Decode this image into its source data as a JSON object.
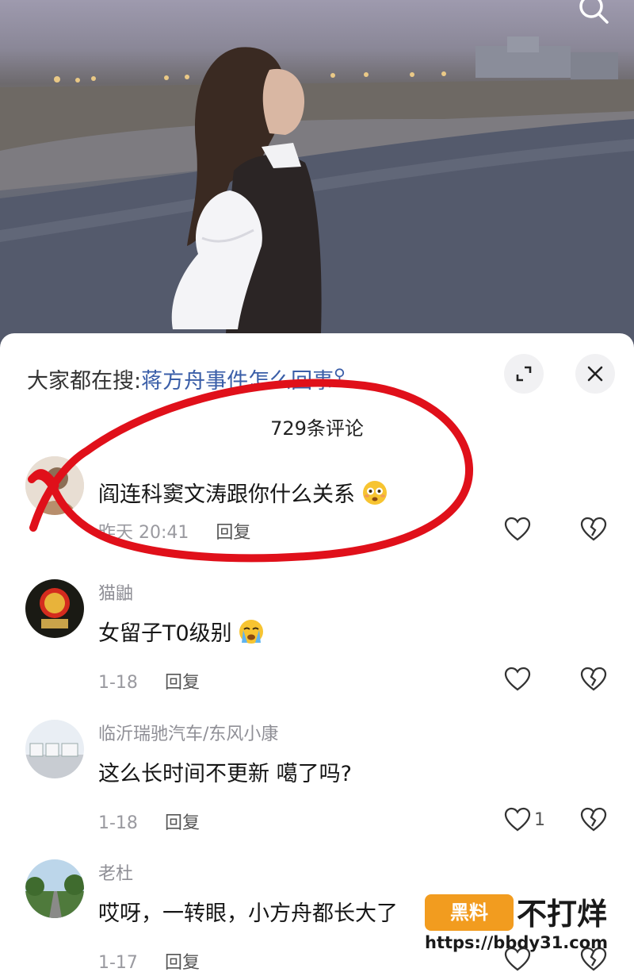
{
  "hot_search": {
    "prefix": "大家都在搜:",
    "query": "蒋方舟事件怎么回事",
    "icon": "search-icon"
  },
  "comment_count_label": "729条评论",
  "comments": [
    {
      "username": "",
      "text": "阎连科窦文涛跟你什么关系",
      "emoji": "flushed-face-emoji",
      "time": "昨天 20:41",
      "reply_label": "回复",
      "likes": ""
    },
    {
      "username": "猫鼬",
      "text": "女留子T0级别",
      "emoji": "crying-face-emoji",
      "time": "1-18",
      "reply_label": "回复",
      "likes": ""
    },
    {
      "username": "临沂瑞驰汽车/东风小康",
      "text": "这么长时间不更新  噶了吗?",
      "time": "1-18",
      "reply_label": "回复",
      "likes": "1"
    },
    {
      "username": "老杜",
      "text": "哎呀，一转眼，小方舟都长大了",
      "time": "1-17",
      "reply_label": "回复",
      "likes": ""
    }
  ],
  "watermark": {
    "logo_text": "黑料",
    "title": "不打烊",
    "url": "https://bbdy31.com"
  },
  "colors": {
    "link_blue": "#3a5ea8",
    "annotation_red": "#e0101a",
    "watermark_orange": "#f29c1f"
  }
}
